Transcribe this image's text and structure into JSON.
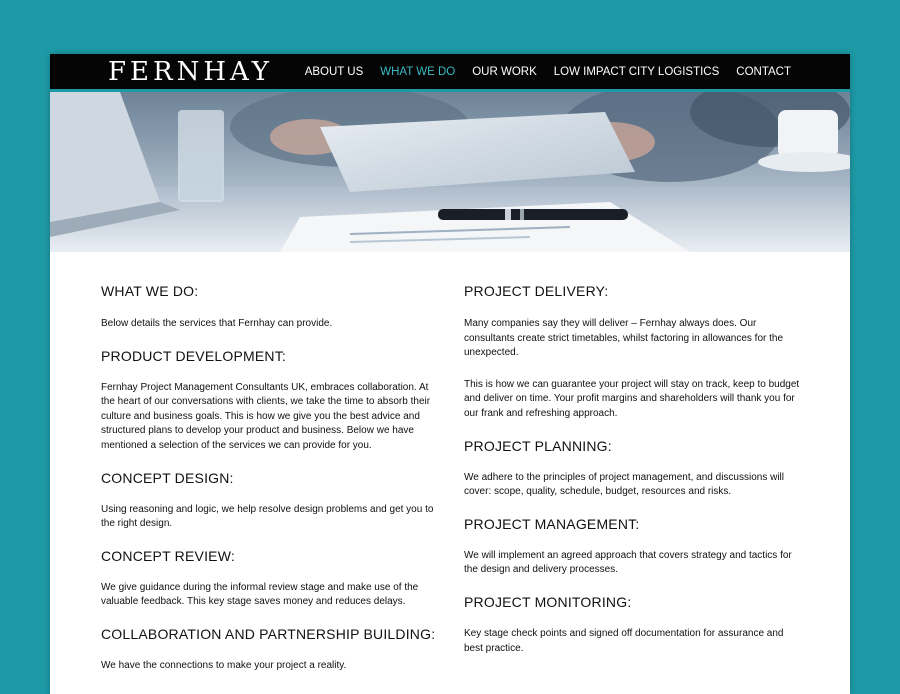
{
  "site": {
    "logo": "FERNHAY"
  },
  "nav": {
    "items": [
      {
        "label": "ABOUT US",
        "active": false
      },
      {
        "label": "WHAT WE DO",
        "active": true
      },
      {
        "label": "OUR WORK",
        "active": false
      },
      {
        "label": "LOW IMPACT CITY LOGISTICS",
        "active": false
      },
      {
        "label": "CONTACT",
        "active": false
      }
    ]
  },
  "colors": {
    "background": "#1d9aa6",
    "nav_bg": "#050505",
    "accent": "#3ab8c4"
  },
  "left": {
    "what_we_do": {
      "heading": "WHAT WE DO:",
      "body": "Below details the services that Fernhay can provide."
    },
    "product_development": {
      "heading": "PRODUCT DEVELOPMENT:",
      "body": "Fernhay Project Management Consultants UK, embraces collaboration. At the heart of our conversations with clients, we take the time to absorb their culture and business goals. This is how we give you the best advice and structured plans to develop your product and business. Below we have mentioned a selection of the services we can provide for you."
    },
    "concept_design": {
      "heading": "CONCEPT DESIGN:",
      "body": "Using reasoning and logic, we help resolve design problems and get you to the right design."
    },
    "concept_review": {
      "heading": "CONCEPT REVIEW:",
      "body": "We give guidance during the informal review stage and make use of the valuable feedback. This key stage saves money and reduces delays."
    },
    "collaboration": {
      "heading": "COLLABORATION AND PARTNERSHIP BUILDING:",
      "body": "We have the connections to make your project a reality."
    }
  },
  "right": {
    "project_delivery": {
      "heading": "PROJECT DELIVERY:",
      "body1": "Many companies say they will deliver – Fernhay always does. Our consultants create strict timetables, whilst factoring in allowances for the unexpected.",
      "body2": "This is how we can guarantee your project will stay on track, keep to budget and deliver on time. Your profit margins and shareholders will thank you for our frank and refreshing approach."
    },
    "project_planning": {
      "heading": "PROJECT PLANNING:",
      "body": "We adhere to the principles of project management, and discussions will cover: scope, quality, schedule, budget, resources and risks."
    },
    "project_management": {
      "heading": "PROJECT MANAGEMENT:",
      "body": "We will implement an agreed approach that covers strategy and tactics for the design and delivery processes."
    },
    "project_monitoring": {
      "heading": "PROJECT MONITORING:",
      "body": "Key stage check points and signed off documentation for assurance and best practice."
    }
  }
}
